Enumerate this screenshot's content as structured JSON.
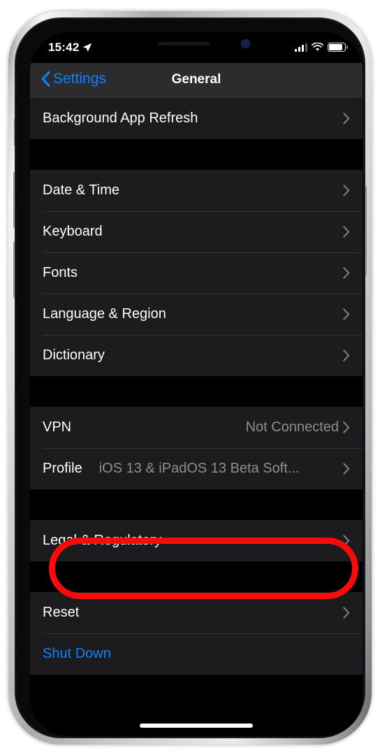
{
  "device": {
    "frame_color": "#c9ccd0",
    "screen_bg": "#000000"
  },
  "status_bar": {
    "time": "15:42",
    "location_icon": "location-arrow-icon",
    "signal_icon": "cellular-signal-icon",
    "signal_bars_filled": 3,
    "signal_bars_total": 4,
    "wifi_icon": "wifi-icon",
    "battery_icon": "battery-icon",
    "battery_level_percent": 92
  },
  "nav_bar": {
    "back_label": "Settings",
    "back_icon": "chevron-left-icon",
    "title": "General",
    "accent_color": "#0a84ff"
  },
  "sections": [
    {
      "id": "background-refresh",
      "rows": [
        {
          "label": "Background App Refresh",
          "value": "",
          "accessory": "chevron-right-icon",
          "style": "default"
        }
      ]
    },
    {
      "id": "datetime-group",
      "rows": [
        {
          "label": "Date & Time",
          "value": "",
          "accessory": "chevron-right-icon",
          "style": "default"
        },
        {
          "label": "Keyboard",
          "value": "",
          "accessory": "chevron-right-icon",
          "style": "default"
        },
        {
          "label": "Fonts",
          "value": "",
          "accessory": "chevron-right-icon",
          "style": "default"
        },
        {
          "label": "Language & Region",
          "value": "",
          "accessory": "chevron-right-icon",
          "style": "default"
        },
        {
          "label": "Dictionary",
          "value": "",
          "accessory": "chevron-right-icon",
          "style": "default"
        }
      ]
    },
    {
      "id": "vpn-group",
      "rows": [
        {
          "label": "VPN",
          "value": "Not Connected",
          "accessory": "chevron-right-icon",
          "style": "default"
        },
        {
          "label": "Profile",
          "value": "iOS 13 & iPadOS 13 Beta Soft...",
          "accessory": "chevron-right-icon",
          "style": "default"
        }
      ]
    },
    {
      "id": "legal-group",
      "rows": [
        {
          "label": "Legal & Regulatory",
          "value": "",
          "accessory": "chevron-right-icon",
          "style": "default"
        }
      ]
    },
    {
      "id": "reset-group",
      "rows": [
        {
          "label": "Reset",
          "value": "",
          "accessory": "chevron-right-icon",
          "style": "default"
        },
        {
          "label": "Shut Down",
          "value": "",
          "accessory": "none",
          "style": "blue"
        }
      ]
    }
  ],
  "annotation": {
    "type": "oval-highlight",
    "target_label": "Reset",
    "color": "#fa0a0a",
    "stroke_width_px": 9
  },
  "home_indicator": {
    "name": "home-indicator",
    "color": "#ffffff"
  }
}
